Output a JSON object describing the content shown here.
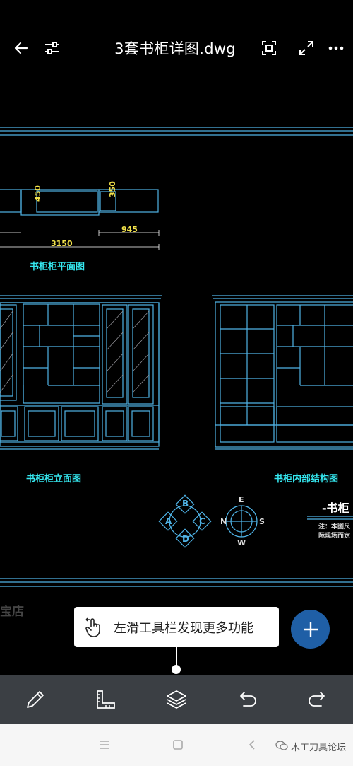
{
  "header": {
    "title": "3套书柜详图.dwg"
  },
  "drawing": {
    "plan_label": "书柜柜平面图",
    "elevation_label": "书柜柜立面图",
    "interior_label": "书柜内部结构图",
    "partial_title": "-书柜",
    "note_line1": "注：本图尺",
    "note_line2": "际现场而定",
    "dim_450": "450",
    "dim_350": "350",
    "dim_945": "945",
    "dim_3150": "3150",
    "bottom_left_text": "宝店",
    "compass": {
      "n": "N",
      "e": "E",
      "s": "S",
      "w": "W"
    },
    "view_markers": {
      "a": "A",
      "b": "B",
      "c": "C",
      "d": "D"
    }
  },
  "tooltip": {
    "text": "左滑工具栏发现更多功能"
  },
  "watermark": {
    "text": "木工刀具论坛"
  },
  "colors": {
    "cad_line": "#4fb3e6",
    "cad_cyan": "#35e8f0",
    "cad_yellow": "#f2e24a",
    "toolbar_bg": "#3b3f44",
    "fab": "#1f5fa6"
  }
}
